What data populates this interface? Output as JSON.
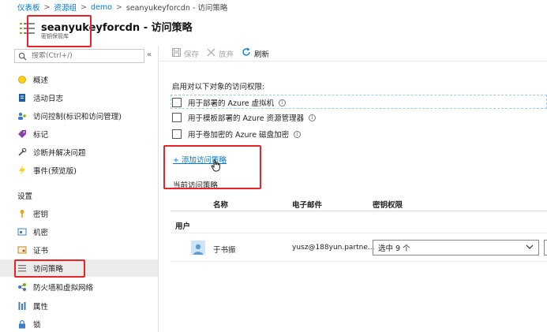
{
  "breadcrumb": {
    "items": [
      "仪表板",
      "资源组",
      "demo",
      "seanyukeyforcdn - 访问策略"
    ]
  },
  "header": {
    "title": "seanyukeyforcdn - 访问策略",
    "subtitle": "密钥保管库"
  },
  "sidebar": {
    "search_placeholder": "搜索(Ctrl+/)",
    "collapse_glyph": "«",
    "items": [
      {
        "label": "概述",
        "icon": "overview-icon"
      },
      {
        "label": "活动日志",
        "icon": "activity-log-icon"
      },
      {
        "label": "访问控制(标识和访问管理)",
        "icon": "iam-icon"
      },
      {
        "label": "标记",
        "icon": "tag-icon"
      },
      {
        "label": "诊断并解决问题",
        "icon": "wrench-icon"
      },
      {
        "label": "事件(预览版)",
        "icon": "lightning-icon"
      }
    ],
    "settings_title": "设置",
    "settings_items": [
      {
        "label": "密钥",
        "icon": "key-icon"
      },
      {
        "label": "机密",
        "icon": "secret-icon"
      },
      {
        "label": "证书",
        "icon": "certificate-icon"
      },
      {
        "label": "访问策略",
        "icon": "access-policy-icon"
      },
      {
        "label": "防火墙和虚拟网络",
        "icon": "network-icon"
      },
      {
        "label": "属性",
        "icon": "properties-icon"
      },
      {
        "label": "锁",
        "icon": "lock-icon"
      }
    ]
  },
  "toolbar": {
    "save_label": "保存",
    "discard_label": "放弃",
    "refresh_label": "刷新"
  },
  "main": {
    "enable_label": "启用对以下对象的访问权限:",
    "checkboxes": [
      {
        "label": "用于部署的 Azure 虚拟机",
        "checked": false
      },
      {
        "label": "用于模板部署的 Azure 资源管理器",
        "checked": false
      },
      {
        "label": "用于卷加密的 Azure 磁盘加密",
        "checked": false
      }
    ],
    "add_policy_label": "+ 添加访问策略",
    "current_policies_title": "当前访问策略",
    "table": {
      "headers": [
        "名称",
        "电子邮件",
        "密钥权限"
      ],
      "group_label": "用户",
      "rows": [
        {
          "name": "于书振",
          "email": "yusz@188yun.partne...",
          "key_permissions": "选中 9 个"
        }
      ]
    }
  },
  "colors": {
    "accent": "#0078d4",
    "highlight": "#e8242a"
  }
}
